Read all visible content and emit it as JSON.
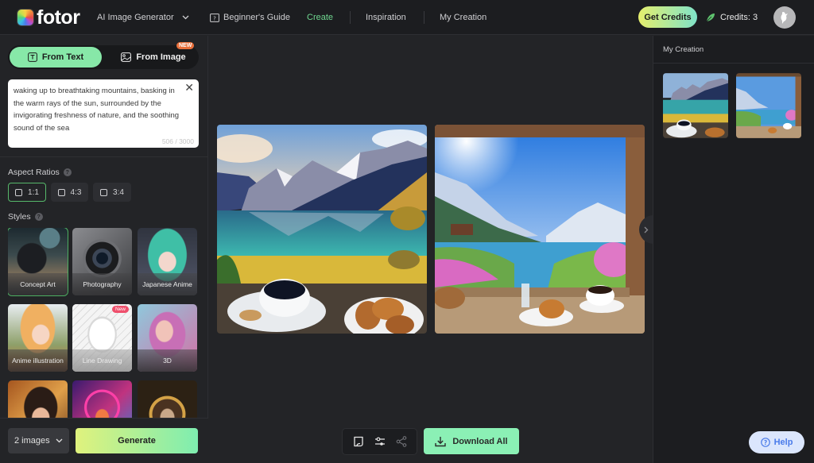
{
  "header": {
    "logo_text": "fotor",
    "product_menu": "AI Image Generator",
    "nav": [
      {
        "label": "Beginner's Guide",
        "icon": "guide-icon"
      },
      {
        "label": "Create",
        "active": true
      },
      {
        "label": "Inspiration"
      },
      {
        "label": "My Creation"
      }
    ],
    "get_credits_label": "Get Credits",
    "credits_label": "Credits: 3",
    "accent_color": "#6fd68f"
  },
  "left_panel": {
    "modes": [
      {
        "label": "From Text",
        "active": true
      },
      {
        "label": "From Image",
        "badge": "NEW"
      }
    ],
    "prompt": {
      "value": "waking up to breathtaking mountains, basking in the warm rays of the sun, surrounded by the invigorating freshness of nature, and the soothing sound of the sea",
      "count": "506 / 3000"
    },
    "aspect_ratios_title": "Aspect Ratios",
    "aspect_ratios": [
      {
        "label": "1:1",
        "active": true
      },
      {
        "label": "4:3"
      },
      {
        "label": "3:4"
      }
    ],
    "styles_title": "Styles",
    "styles": [
      {
        "label": "Concept Art",
        "active": true
      },
      {
        "label": "Photography"
      },
      {
        "label": "Japanese Anime"
      },
      {
        "label": "Anime illustration"
      },
      {
        "label": "Line Drawing",
        "badge": "New"
      },
      {
        "label": "3D"
      },
      {
        "label": ""
      },
      {
        "label": ""
      },
      {
        "label": ""
      }
    ],
    "image_count": "2 images",
    "generate_label": "Generate"
  },
  "main": {
    "results": [
      {
        "alt": "mountain lake with coffee and croissants"
      },
      {
        "alt": "window view of alpine lake with coffee and croissant"
      }
    ],
    "download_all_label": "Download All"
  },
  "right_panel": {
    "title": "My Creation"
  },
  "help_label": "Help"
}
